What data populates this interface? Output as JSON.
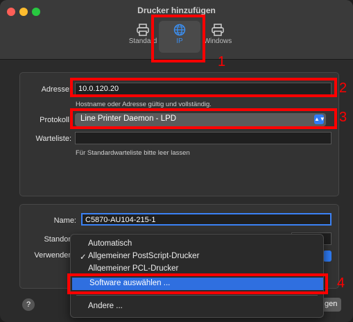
{
  "window": {
    "title": "Drucker hinzufügen"
  },
  "toolbar": {
    "tabs": [
      {
        "label": "Standard",
        "icon": "printer-icon"
      },
      {
        "label": "IP",
        "icon": "globe-icon"
      },
      {
        "label": "Windows",
        "icon": "printer-windows-icon"
      }
    ]
  },
  "form": {
    "address_label": "Adresse:",
    "address_value": "10.0.120.20",
    "address_hint": "Hostname oder Adresse gültig und vollständig.",
    "protocol_label": "Protokoll:",
    "protocol_value": "Line Printer Daemon - LPD",
    "queue_label": "Warteliste:",
    "queue_value": "",
    "queue_hint": "Für Standardwarteliste bitte leer lassen",
    "name_label": "Name:",
    "name_value": "C5870-AU104-215-1",
    "location_label": "Standor",
    "use_label": "Verwender"
  },
  "menu": {
    "items": [
      {
        "label": "Automatisch",
        "checked": false
      },
      {
        "label": "Allgemeiner PostScript-Drucker",
        "checked": true
      },
      {
        "label": "Allgemeiner PCL-Drucker",
        "checked": false
      },
      {
        "label": "Software auswählen ...",
        "checked": false,
        "selected": true
      },
      {
        "label": "Andere ...",
        "checked": false
      }
    ],
    "checkmark": "✓"
  },
  "footer": {
    "help_label": "?",
    "add_button_partial": "gen"
  },
  "annotations": {
    "n1": "1",
    "n2": "2",
    "n3": "3",
    "n4": "4"
  },
  "colors": {
    "accent": "#2f6fe0",
    "annotation": "#ff0000"
  }
}
